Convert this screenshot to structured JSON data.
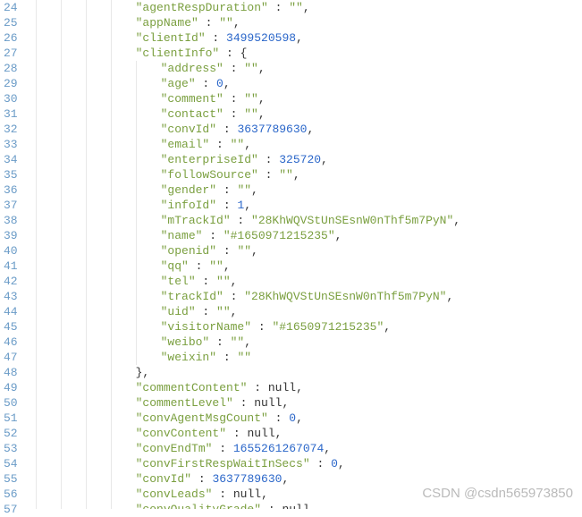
{
  "watermark": "CSDN @csdn565973850",
  "gutter": {
    "start": 24,
    "end": 57,
    "foldable": [
      27,
      48
    ]
  },
  "lines": [
    {
      "depth": 4,
      "key": "agentRespDuration",
      "val": "\"\"",
      "vtype": "str",
      "comma": true
    },
    {
      "depth": 4,
      "key": "appName",
      "val": "\"\"",
      "vtype": "str",
      "comma": true
    },
    {
      "depth": 4,
      "key": "clientId",
      "val": "3499520598",
      "vtype": "num",
      "comma": true
    },
    {
      "depth": 4,
      "key": "clientInfo",
      "val": "{",
      "vtype": "punc",
      "comma": false
    },
    {
      "depth": 5,
      "key": "address",
      "val": "\"\"",
      "vtype": "str",
      "comma": true
    },
    {
      "depth": 5,
      "key": "age",
      "val": "0",
      "vtype": "num",
      "comma": true
    },
    {
      "depth": 5,
      "key": "comment",
      "val": "\"\"",
      "vtype": "str",
      "comma": true
    },
    {
      "depth": 5,
      "key": "contact",
      "val": "\"\"",
      "vtype": "str",
      "comma": true
    },
    {
      "depth": 5,
      "key": "convId",
      "val": "3637789630",
      "vtype": "num",
      "comma": true
    },
    {
      "depth": 5,
      "key": "email",
      "val": "\"\"",
      "vtype": "str",
      "comma": true
    },
    {
      "depth": 5,
      "key": "enterpriseId",
      "val": "325720",
      "vtype": "num",
      "comma": true
    },
    {
      "depth": 5,
      "key": "followSource",
      "val": "\"\"",
      "vtype": "str",
      "comma": true
    },
    {
      "depth": 5,
      "key": "gender",
      "val": "\"\"",
      "vtype": "str",
      "comma": true
    },
    {
      "depth": 5,
      "key": "infoId",
      "val": "1",
      "vtype": "num",
      "comma": true
    },
    {
      "depth": 5,
      "key": "mTrackId",
      "val": "\"28KhWQVStUnSEsnW0nThf5m7PyN\"",
      "vtype": "str",
      "comma": true
    },
    {
      "depth": 5,
      "key": "name",
      "val": "\"#1650971215235\"",
      "vtype": "str",
      "comma": true
    },
    {
      "depth": 5,
      "key": "openid",
      "val": "\"\"",
      "vtype": "str",
      "comma": true
    },
    {
      "depth": 5,
      "key": "qq",
      "val": "\"\"",
      "vtype": "str",
      "comma": true
    },
    {
      "depth": 5,
      "key": "tel",
      "val": "\"\"",
      "vtype": "str",
      "comma": true
    },
    {
      "depth": 5,
      "key": "trackId",
      "val": "\"28KhWQVStUnSEsnW0nThf5m7PyN\"",
      "vtype": "str",
      "comma": true
    },
    {
      "depth": 5,
      "key": "uid",
      "val": "\"\"",
      "vtype": "str",
      "comma": true
    },
    {
      "depth": 5,
      "key": "visitorName",
      "val": "\"#1650971215235\"",
      "vtype": "str",
      "comma": true
    },
    {
      "depth": 5,
      "key": "weibo",
      "val": "\"\"",
      "vtype": "str",
      "comma": true
    },
    {
      "depth": 5,
      "key": "weixin",
      "val": "\"\"",
      "vtype": "str",
      "comma": false
    },
    {
      "depth": 4,
      "close": "},",
      "comma": false
    },
    {
      "depth": 4,
      "key": "commentContent",
      "val": "null",
      "vtype": "null",
      "comma": true
    },
    {
      "depth": 4,
      "key": "commentLevel",
      "val": "null",
      "vtype": "null",
      "comma": true
    },
    {
      "depth": 4,
      "key": "convAgentMsgCount",
      "val": "0",
      "vtype": "num",
      "comma": true
    },
    {
      "depth": 4,
      "key": "convContent",
      "val": "null",
      "vtype": "null",
      "comma": true
    },
    {
      "depth": 4,
      "key": "convEndTm",
      "val": "1655261267074",
      "vtype": "num",
      "comma": true
    },
    {
      "depth": 4,
      "key": "convFirstRespWaitInSecs",
      "val": "0",
      "vtype": "num",
      "comma": true
    },
    {
      "depth": 4,
      "key": "convId",
      "val": "3637789630",
      "vtype": "num",
      "comma": true
    },
    {
      "depth": 4,
      "key": "convLeads",
      "val": "null",
      "vtype": "null",
      "comma": true
    },
    {
      "depth": 4,
      "key": "convQualityGrade",
      "val": "null",
      "vtype": "null",
      "comma": true,
      "cut": true
    }
  ]
}
